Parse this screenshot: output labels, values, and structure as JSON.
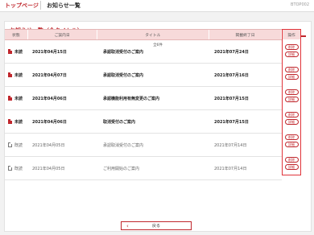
{
  "header": {
    "home_label": "トップページ",
    "page_title": "お知らせ一覧",
    "screen_code": "BTOP002"
  },
  "panel": {
    "title": "お知らせ一覧（全タイトル）",
    "count_text": "全6件"
  },
  "table": {
    "headers": {
      "status": "状態",
      "date": "ご案内日",
      "title": "タイトル",
      "end": "掲載終了日",
      "ops": "操作"
    },
    "rows": [
      {
        "status": "未読",
        "date": "2021年04月15日",
        "title": "承認取消受付のご案内",
        "end": "2021年07月24日"
      },
      {
        "status": "未読",
        "date": "2021年04月07日",
        "title": "承認取消受付のご案内",
        "end": "2021年07月16日"
      },
      {
        "status": "未読",
        "date": "2021年04月06日",
        "title": "承認機能利用有無変更のご案内",
        "end": "2021年07月15日"
      },
      {
        "status": "未読",
        "date": "2021年04月06日",
        "title": "取消受付のご案内",
        "end": "2021年07月15日"
      },
      {
        "status": "既読",
        "date": "2021年04月05日",
        "title": "承認取消受付のご案内",
        "end": "2021年07月14日"
      },
      {
        "status": "既読",
        "date": "2021年04月05日",
        "title": "ご利用開始のご案内",
        "end": "2021年07月14日"
      }
    ],
    "delete_label": "削除",
    "detail_label": "詳細"
  },
  "back_label": "戻る",
  "icons": {
    "unread": "document-red-icon",
    "read": "document-gray-icon",
    "back": "chevron-left-icon"
  },
  "colors": {
    "accent": "#c0272d",
    "header_bg": "#f7dada"
  }
}
